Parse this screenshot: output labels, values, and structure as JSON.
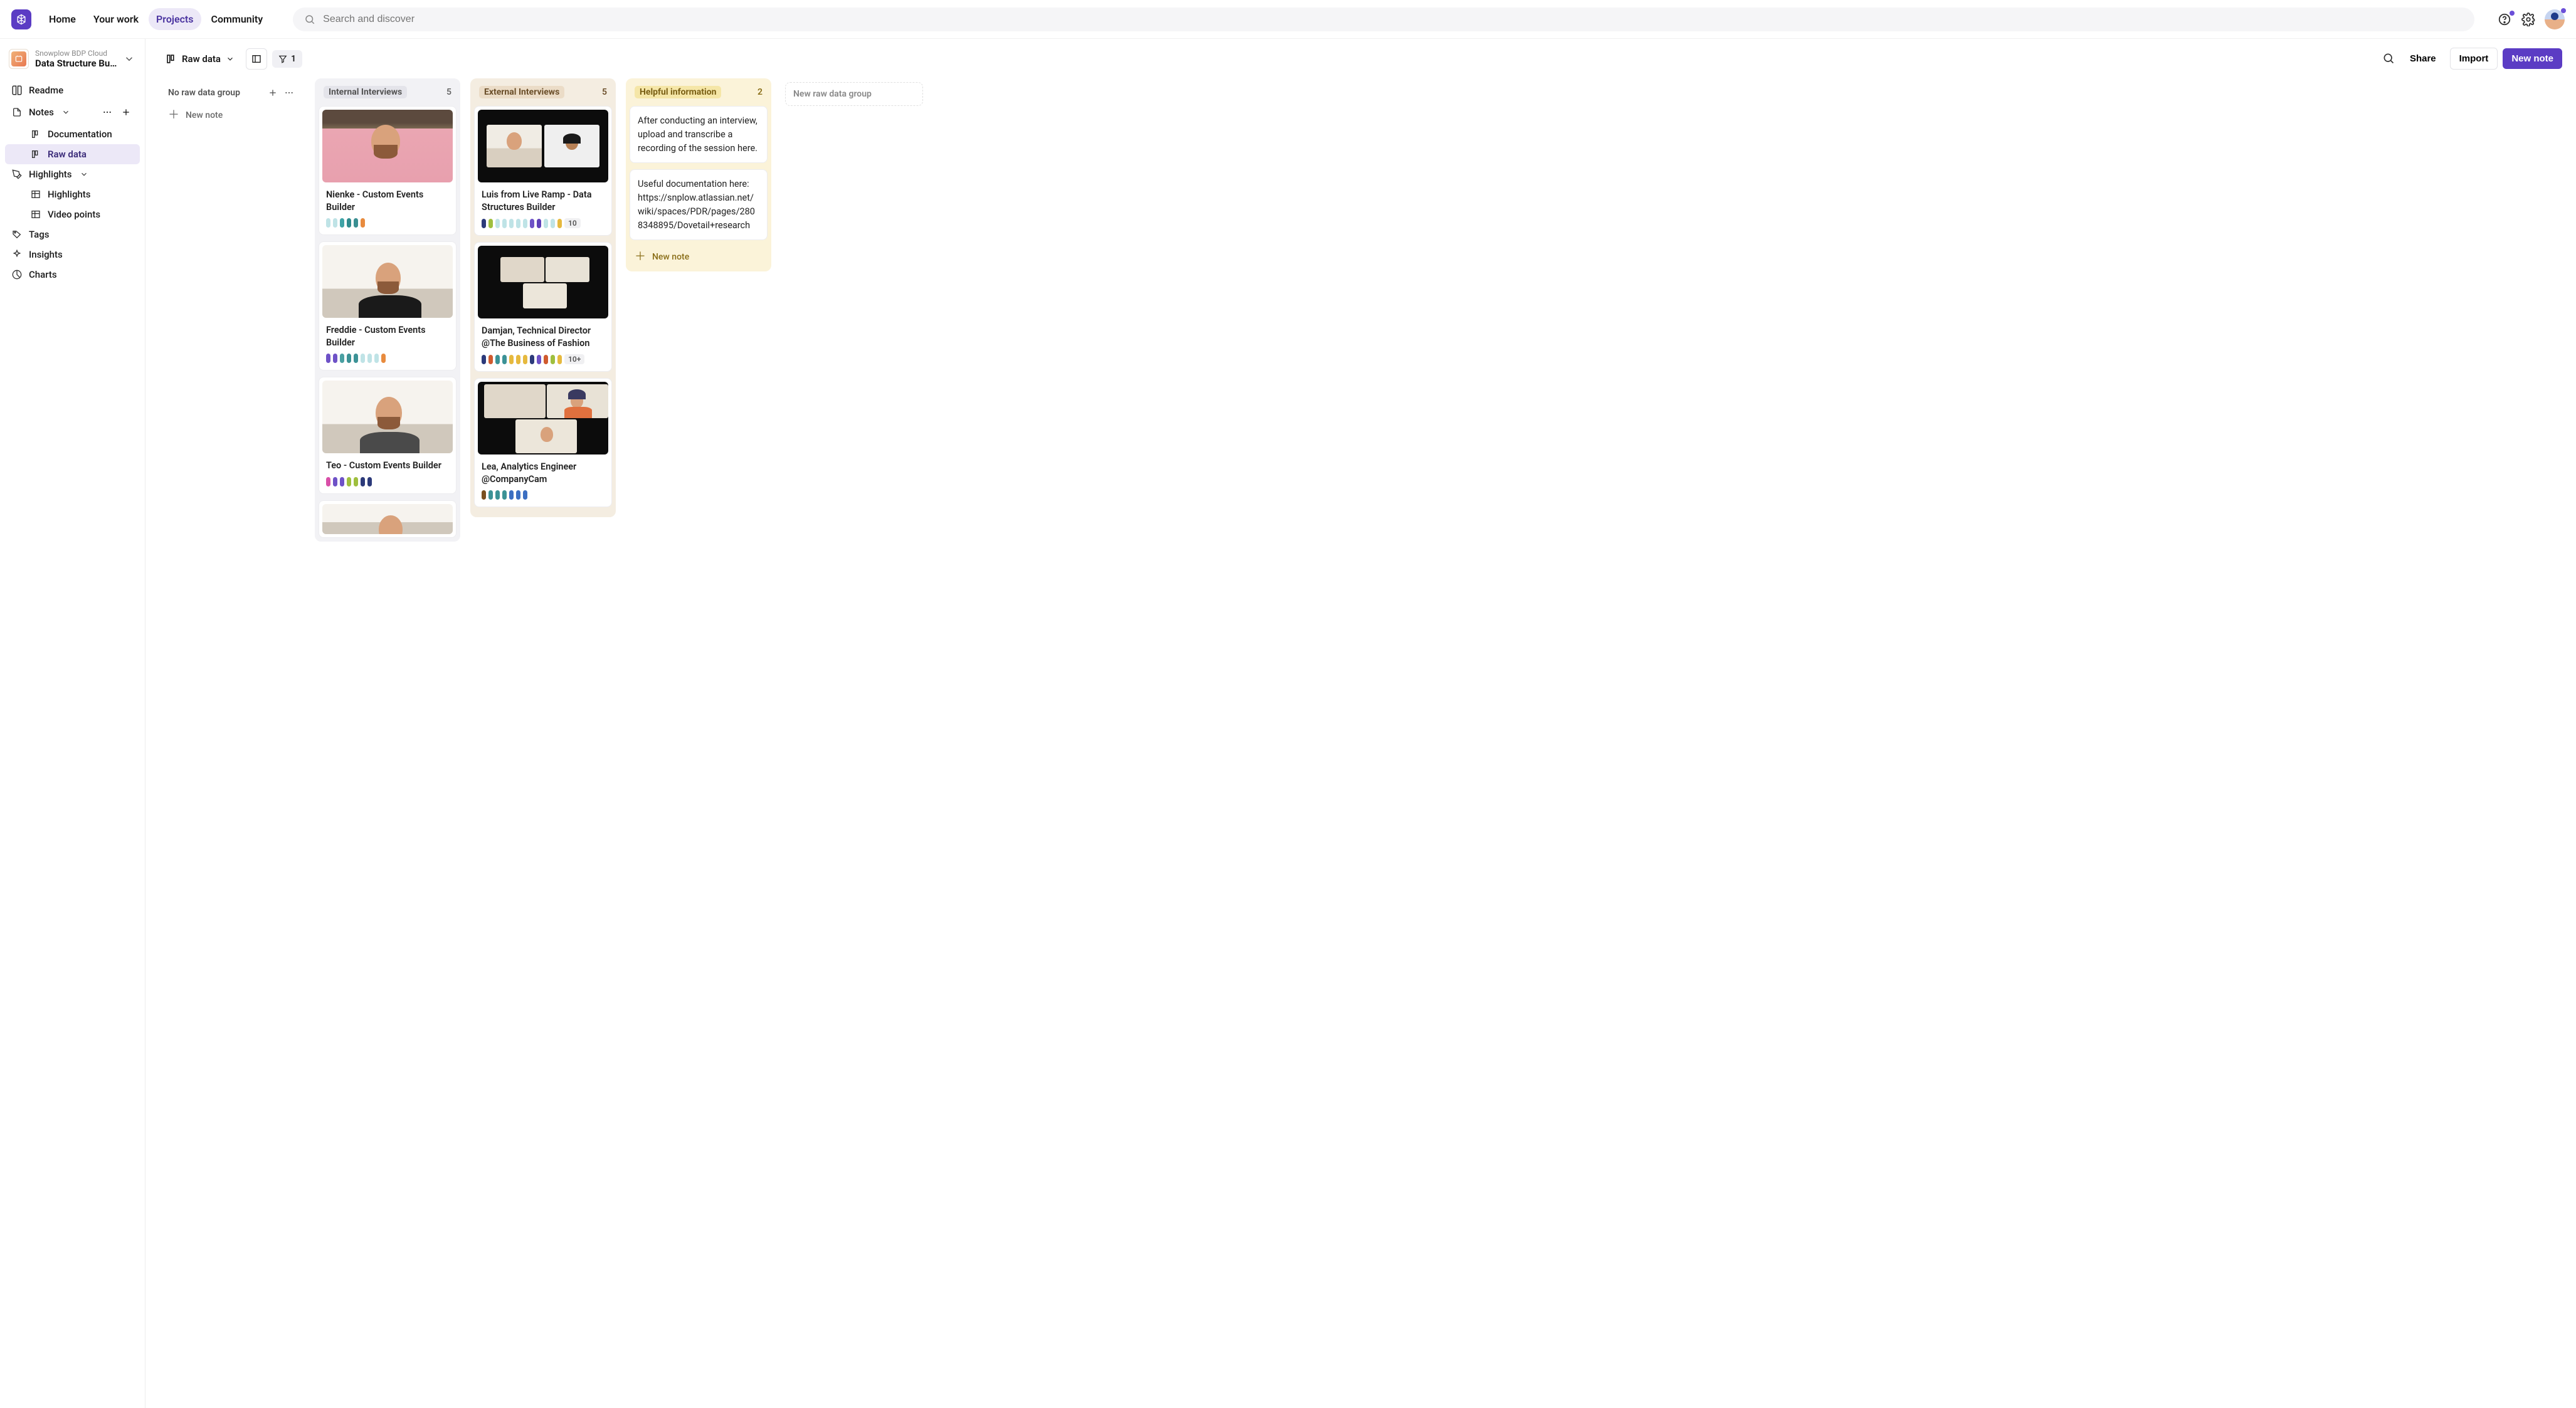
{
  "nav": {
    "home": "Home",
    "your_work": "Your work",
    "projects": "Projects",
    "community": "Community"
  },
  "search": {
    "placeholder": "Search and discover"
  },
  "project": {
    "org": "Snowplow BDP Cloud",
    "name": "Data Structure Build…"
  },
  "sidebar": {
    "readme": "Readme",
    "notes": "Notes",
    "documentation": "Documentation",
    "raw_data": "Raw data",
    "highlights_section": "Highlights",
    "highlights": "Highlights",
    "video_points": "Video points",
    "tags": "Tags",
    "insights": "Insights",
    "charts": "Charts"
  },
  "toolbar": {
    "view_label": "Raw data",
    "filter_count": "1",
    "share": "Share",
    "import": "Import",
    "new_note": "New note"
  },
  "board": {
    "no_group": {
      "title": "No raw data group",
      "new_note": "New note"
    },
    "new_group": "New raw data group",
    "columns": [
      {
        "title": "Internal Interviews",
        "count": "5",
        "cards": [
          {
            "title": "Nienke - Custom Events Builder",
            "tags": [
              "#bfe3e6",
              "#bfe3e6",
              "#3fa3a6",
              "#2f8b8e",
              "#3a8f92",
              "#e88b3e"
            ]
          },
          {
            "title": "Freddie - Custom Events Builder",
            "tags": [
              "#6e52c7",
              "#6e52c7",
              "#4aa0a2",
              "#3c9296",
              "#3c9296",
              "#bfe3e6",
              "#bfe3e6",
              "#bfe3e6",
              "#e88b3e"
            ]
          },
          {
            "title": "Teo - Custom Events Builder",
            "tags": [
              "#d94fa8",
              "#6e52c7",
              "#6e52c7",
              "#9fbf3e",
              "#9fbf3e",
              "#2c3a7a",
              "#2c3a7a"
            ]
          }
        ]
      },
      {
        "title": "External Interviews",
        "count": "5",
        "cards": [
          {
            "title": "Luis from Live Ramp - Data Structures Builder",
            "tags": [
              "#2c3a7a",
              "#9fbf3e",
              "#bfe3e6",
              "#bfe3e6",
              "#bfe3e6",
              "#bfe3e6",
              "#bfe3e6",
              "#6e52c7",
              "#5f40b8",
              "#bfe3e6",
              "#bfe3e6",
              "#e6b93e"
            ],
            "more": "10"
          },
          {
            "title": "Damjan, Technical Director @The Business of Fashion",
            "tags": [
              "#2c3a7a",
              "#d05a2e",
              "#3c9296",
              "#3c9296",
              "#e6b93e",
              "#e6b93e",
              "#e6b93e",
              "#2c3a7a",
              "#6e52c7",
              "#d05a2e",
              "#9fbf3e",
              "#e6b93e"
            ],
            "more": "10+"
          },
          {
            "title": "Lea, Analytics Engineer @CompanyCam",
            "tags": [
              "#7a5020",
              "#3c9296",
              "#3c9296",
              "#3c9296",
              "#3c6fc2",
              "#3c6fc2",
              "#3c6fc2"
            ]
          }
        ]
      },
      {
        "title": "Helpful information",
        "count": "2",
        "notes": [
          "After conducting an interview, upload and transcribe a recording of the session here.",
          "Useful documentation here: https://snplow.atlassian.net/wiki/spaces/PDR/pages/2808348895/Dovetail+research"
        ],
        "new_note": "New note"
      }
    ]
  }
}
